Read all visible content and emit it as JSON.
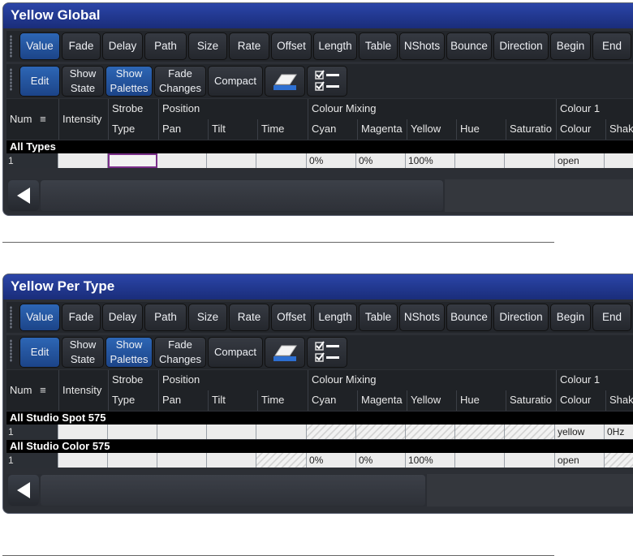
{
  "toolbar_tabs": [
    "Value",
    "Fade",
    "Delay",
    "Path",
    "Size",
    "Rate",
    "Offset",
    "Length",
    "Table",
    "NShots",
    "Bounce",
    "Direction",
    "Begin",
    "End"
  ],
  "toolbar_actions": {
    "edit": "Edit",
    "show_state": [
      "Show",
      "State"
    ],
    "show_palettes": [
      "Show",
      "Palettes"
    ],
    "fade_changes": [
      "Fade",
      "Changes"
    ],
    "compact": "Compact",
    "icons": [
      "eraser-icon",
      "checklist-icon"
    ]
  },
  "header_groups": [
    "Num",
    "Intensity",
    "Strobe",
    "Position",
    "Colour Mixing",
    "Colour 1"
  ],
  "header_columns": [
    "Type",
    "Pan",
    "Tilt",
    "Time",
    "Cyan",
    "Magenta",
    "Yellow",
    "Hue",
    "Saturatio",
    "Colour",
    "Shake"
  ],
  "panels": [
    {
      "title": "Yellow Global",
      "groups": [
        {
          "name": "All Types",
          "rows": [
            {
              "num": "1",
              "cyan": "0%",
              "magenta": "0%",
              "yellow": "100%",
              "colour": "open",
              "shake": ""
            }
          ]
        }
      ]
    },
    {
      "title": "Yellow Per Type",
      "groups": [
        {
          "name": "All Studio Spot 575",
          "rows": [
            {
              "num": "1",
              "cyan": "",
              "magenta": "",
              "yellow": "",
              "colour": "yellow",
              "shake": "0Hz"
            }
          ]
        },
        {
          "name": "All Studio Color 575",
          "rows": [
            {
              "num": "1",
              "cyan": "0%",
              "magenta": "0%",
              "yellow": "100%",
              "colour": "open",
              "shake": ""
            }
          ]
        }
      ]
    }
  ]
}
